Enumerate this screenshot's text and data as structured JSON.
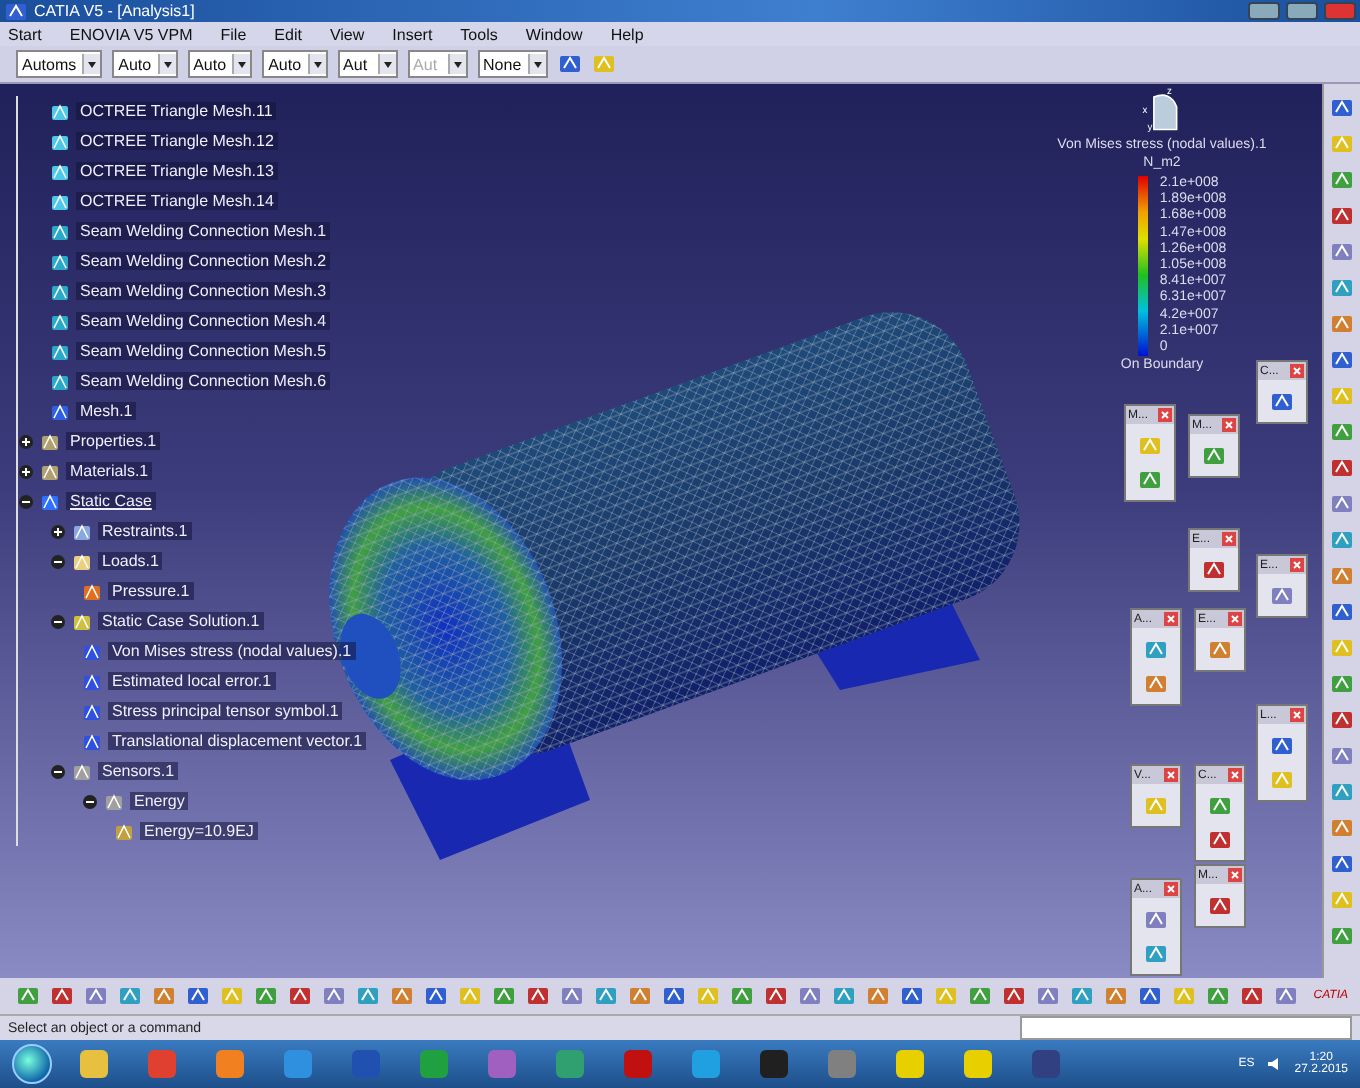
{
  "window": {
    "title": "CATIA V5 - [Analysis1]"
  },
  "menu": [
    "Start",
    "ENOVIA V5 VPM",
    "File",
    "Edit",
    "View",
    "Insert",
    "Tools",
    "Window",
    "Help"
  ],
  "toolbar": {
    "dropdowns": [
      {
        "value": "Automs",
        "disabled": false
      },
      {
        "value": "Auto",
        "disabled": false
      },
      {
        "value": "Auto",
        "disabled": false
      },
      {
        "value": "Auto",
        "disabled": false
      },
      {
        "value": "Aut",
        "disabled": false
      },
      {
        "value": "Aut",
        "disabled": true
      },
      {
        "value": "None",
        "disabled": false
      }
    ]
  },
  "tree": {
    "continued_items": [
      {
        "label": "OCTREE Triangle Mesh.11",
        "kind": "tri-mesh"
      },
      {
        "label": "OCTREE Triangle Mesh.12",
        "kind": "tri-mesh"
      },
      {
        "label": "OCTREE Triangle Mesh.13",
        "kind": "tri-mesh"
      },
      {
        "label": "OCTREE Triangle Mesh.14",
        "kind": "tri-mesh"
      },
      {
        "label": "Seam Welding Connection Mesh.1",
        "kind": "seam-mesh"
      },
      {
        "label": "Seam Welding Connection Mesh.2",
        "kind": "seam-mesh"
      },
      {
        "label": "Seam Welding Connection Mesh.3",
        "kind": "seam-mesh"
      },
      {
        "label": "Seam Welding Connection Mesh.4",
        "kind": "seam-mesh"
      },
      {
        "label": "Seam Welding Connection Mesh.5",
        "kind": "seam-mesh"
      },
      {
        "label": "Seam Welding Connection Mesh.6",
        "kind": "seam-mesh"
      },
      {
        "label": "Mesh.1",
        "kind": "mesh"
      }
    ],
    "items": [
      {
        "label": "Properties.1",
        "kind": "folder",
        "expanded": false
      },
      {
        "label": "Materials.1",
        "kind": "folder",
        "expanded": false
      },
      {
        "label": "Static Case",
        "kind": "case",
        "expanded": true,
        "children": [
          {
            "label": "Restraints.1",
            "kind": "restraint",
            "expanded": false
          },
          {
            "label": "Loads.1",
            "kind": "load",
            "expanded": true,
            "children": [
              {
                "label": "Pressure.1",
                "kind": "pressure"
              }
            ]
          },
          {
            "label": "Static Case Solution.1",
            "kind": "solution",
            "expanded": true,
            "children": [
              {
                "label": "Von Mises stress (nodal values).1",
                "kind": "image"
              },
              {
                "label": "Estimated local error.1",
                "kind": "image"
              },
              {
                "label": "Stress principal tensor symbol.1",
                "kind": "image"
              },
              {
                "label": "Translational displacement vector.1",
                "kind": "image"
              }
            ]
          },
          {
            "label": "Sensors.1",
            "kind": "sensor",
            "expanded": true,
            "children": [
              {
                "label": "Energy",
                "kind": "sensor",
                "expanded": true,
                "children": [
                  {
                    "label": "Energy=10.9EJ",
                    "kind": "value"
                  }
                ]
              }
            ]
          }
        ]
      }
    ]
  },
  "compass": {
    "axes": [
      "z",
      "x",
      "y"
    ]
  },
  "legend": {
    "title": "Von Mises stress (nodal values).1",
    "unit": "N_m2",
    "values": [
      "2.1e+008",
      "1.89e+008",
      "1.68e+008",
      "1.47e+008",
      "1.26e+008",
      "1.05e+008",
      "8.41e+007",
      "6.31e+007",
      "4.2e+007",
      "2.1e+007",
      "0"
    ],
    "footer": "On Boundary"
  },
  "palettes": [
    {
      "title": "C..."
    },
    {
      "title": "M..."
    },
    {
      "title": "M..."
    },
    {
      "title": "E..."
    },
    {
      "title": "E..."
    },
    {
      "title": "A..."
    },
    {
      "title": "E..."
    },
    {
      "title": "L..."
    },
    {
      "title": "V..."
    },
    {
      "title": "C..."
    },
    {
      "title": "M..."
    },
    {
      "title": "A..."
    }
  ],
  "logo": "CATIA",
  "status_bar": {
    "message": "Select an object or a command"
  },
  "taskbar": {
    "language": "ES",
    "time": "1:20",
    "date": "27.2.2015"
  }
}
